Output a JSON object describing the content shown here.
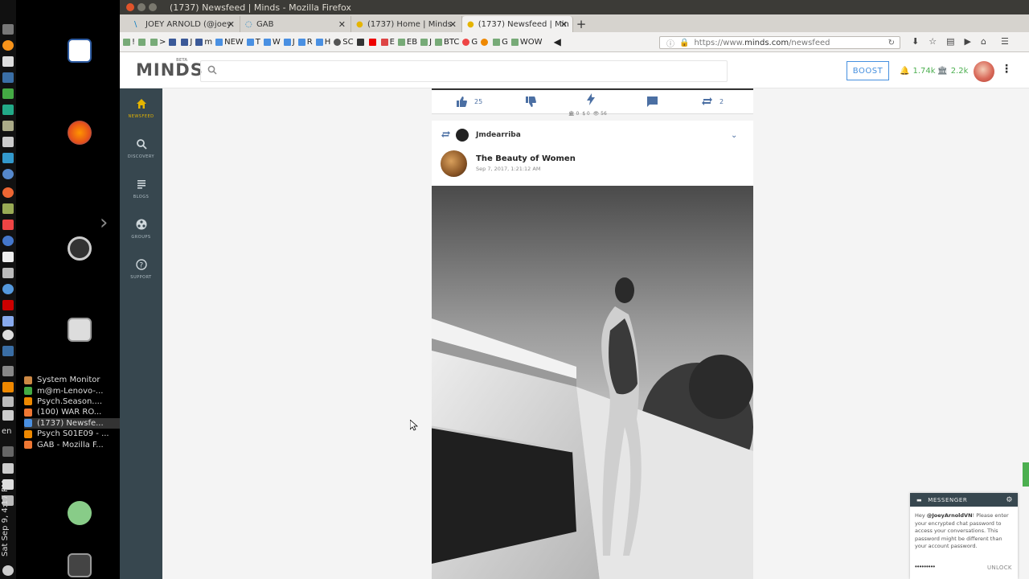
{
  "desktop": {
    "clock": "Sat Sep 9, 4:17 PM",
    "lang": "en",
    "tasks": [
      {
        "label": "System Monitor",
        "color": "#c84"
      },
      {
        "label": "m@m-Lenovo-...",
        "color": "#4a4"
      },
      {
        "label": "Psych.Season....",
        "color": "#e80"
      },
      {
        "label": "(100) WAR RO...",
        "color": "#e73"
      },
      {
        "label": "(1737) Newsfe...",
        "color": "#4a90e2"
      },
      {
        "label": "Psych S01E09 - ...",
        "color": "#e80"
      },
      {
        "label": "GAB - Mozilla F...",
        "color": "#e73"
      }
    ]
  },
  "browser": {
    "window_title": "(1737) Newsfeed | Minds - Mozilla Firefox",
    "tabs": [
      {
        "label": "JOEY ARNOLD (@joey",
        "icon": "steem-icon"
      },
      {
        "label": "GAB",
        "icon": "gab-icon"
      },
      {
        "label": "(1737) Home | Minds",
        "icon": "minds-icon"
      },
      {
        "label": "(1737) Newsfeed | Min",
        "icon": "minds-icon"
      }
    ],
    "bookmarks": [
      "!",
      "",
      ">",
      "",
      "J",
      "m",
      "NEW",
      "T",
      "W",
      "J",
      "R",
      "H",
      "SC",
      "",
      "",
      "E",
      "EB",
      "J",
      "BTC",
      "G",
      "",
      "G",
      "WOW"
    ],
    "url_prefix": "https://www.",
    "url_domain": "minds.com",
    "url_path": "/newsfeed"
  },
  "app": {
    "logo": "MINDS",
    "logo_beta": "BETA",
    "search_placeholder": "",
    "boost_label": "BOOST",
    "notifications": "1.74k",
    "wallet": "2.2k",
    "nav": [
      {
        "label": "NEWSFEED",
        "icon": "home-icon"
      },
      {
        "label": "DISCOVERY",
        "icon": "search-icon"
      },
      {
        "label": "BLOGS",
        "icon": "blog-icon"
      },
      {
        "label": "GROUPS",
        "icon": "groups-icon"
      },
      {
        "label": "SUPPORT",
        "icon": "help-icon"
      }
    ],
    "prev_post": {
      "upvotes": "25",
      "reminds": "2",
      "stat_wire": "0",
      "stat_money": "$ 0",
      "stat_views": "56"
    },
    "post": {
      "reminder": "Jmdearriba",
      "title": "The Beauty of Women",
      "date": "Sep 7, 2017, 1:21:12 AM"
    },
    "messenger": {
      "title": "MESSENGER",
      "greeting": "Hey ",
      "user": "@JoeyArnoldVN",
      "message": "! Please enter your encrypted chat password to access your conversations. This password might be different than your account password.",
      "password": "•••••••••",
      "unlock": "UNLOCK"
    }
  }
}
